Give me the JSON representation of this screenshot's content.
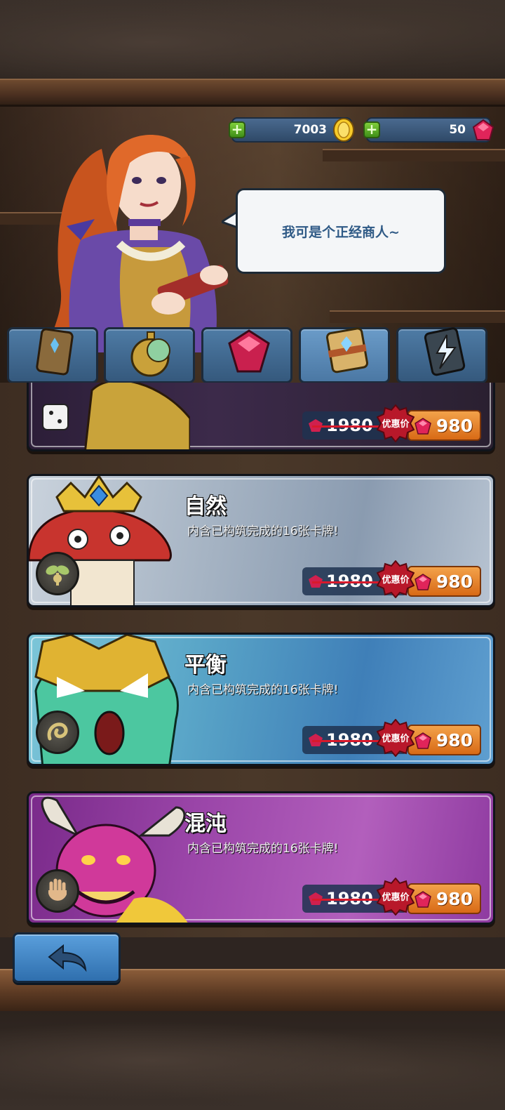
{
  "currency": {
    "gold": "7003",
    "gems": "50",
    "plus_symbol": "+"
  },
  "merchant": {
    "speech": "我可是个正经商人~"
  },
  "tabs": [
    {
      "name": "card-pack",
      "active": false
    },
    {
      "name": "pocket-watch",
      "active": false
    },
    {
      "name": "gem",
      "active": false
    },
    {
      "name": "deck-bundle",
      "active": true
    },
    {
      "name": "spell-card",
      "active": false
    }
  ],
  "bundles": [
    {
      "title": "",
      "description": "",
      "old_price": "1980",
      "discount_label": "优惠价",
      "new_price": "980",
      "color": "#3c2a4a",
      "partial": true
    },
    {
      "title": "自然",
      "description": "内含已构筑完成的16张卡牌!",
      "old_price": "1980",
      "discount_label": "优惠价",
      "new_price": "980",
      "color": "#a9b6c6",
      "type_icon": "sprout-icon"
    },
    {
      "title": "平衡",
      "description": "内含已构筑完成的16张卡牌!",
      "old_price": "1980",
      "discount_label": "优惠价",
      "new_price": "980",
      "color": "#5a9ec0",
      "type_icon": "swirl-icon"
    },
    {
      "title": "混沌",
      "description": "内含已构筑完成的16张卡牌!",
      "old_price": "1980",
      "discount_label": "优惠价",
      "new_price": "980",
      "color": "#9a45a8",
      "type_icon": "hand-icon"
    }
  ]
}
